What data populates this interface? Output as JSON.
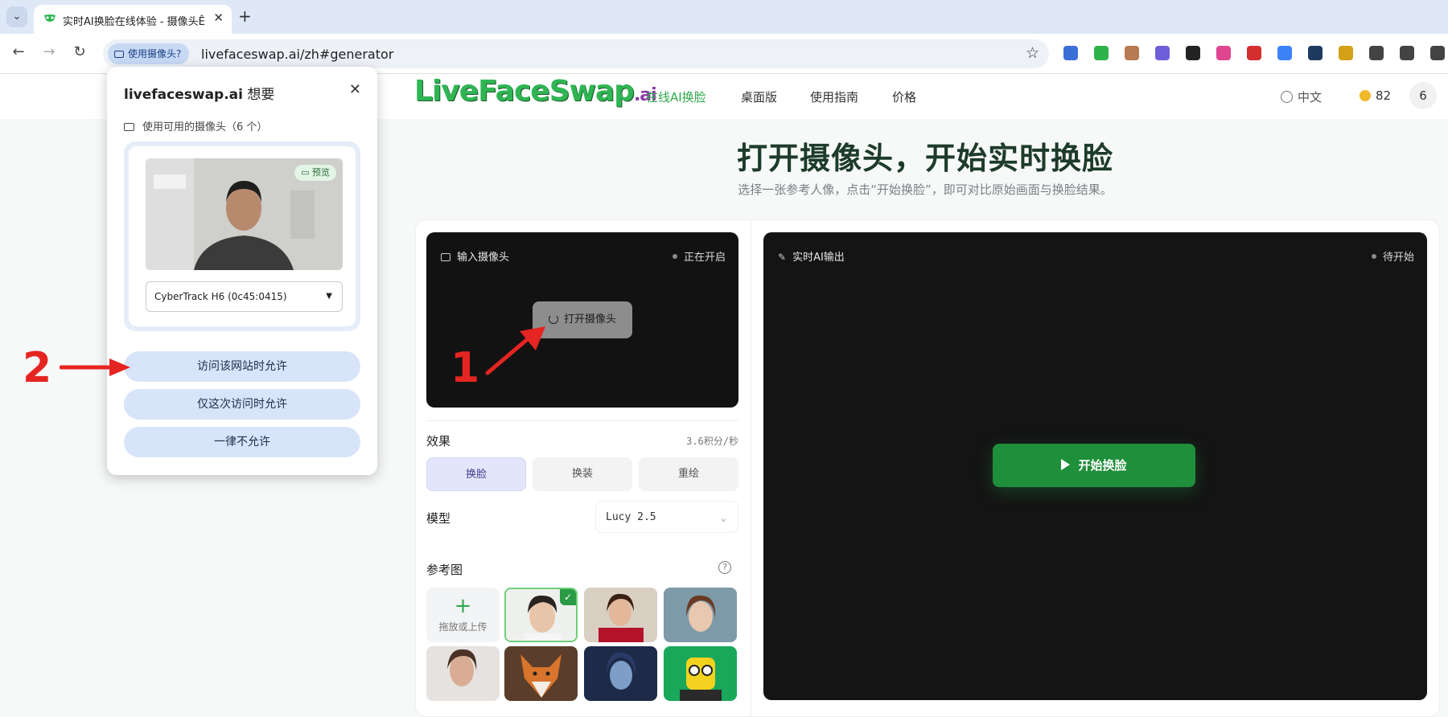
{
  "browser": {
    "tab_title": "实时AI换脸在线体验 - 摄像头Ê",
    "tab_close": "✕",
    "new_tab": "+",
    "camera_chip": "使用摄像头?",
    "url": "livefaceswap.ai/zh#generator",
    "bookmark_icon": "star-icon",
    "extensions": [
      "#3b6fd8",
      "#2eb24a",
      "#b77a52",
      "#6f5ed9",
      "#222222",
      "#e0458f",
      "#d32f2f",
      "#3b82f6",
      "#1e3a5f",
      "#d4a017",
      "#444444",
      "#444444",
      "#444444"
    ]
  },
  "permission_popup": {
    "site": "livefaceswap.ai",
    "wants": "想要",
    "camera_line": "使用可用的摄像头（6 个）",
    "preview_badge": "预览",
    "device": "CyberTrack H6 (0c45:0415)",
    "allow_site": "访问该网站时允许",
    "allow_once": "仅这次访问时允许",
    "never_allow": "一律不允许"
  },
  "site_header": {
    "logo_main": "LiveFaceSwap",
    "logo_suffix": ".ai",
    "nav": [
      "在线AI换脸",
      "桌面版",
      "使用指南",
      "价格"
    ],
    "active_nav": 0,
    "language": "中文",
    "credits": "82",
    "user_initial": "6"
  },
  "hero": {
    "title": "打开摄像头，开始实时换脸",
    "subtitle": "选择一张参考人像，点击“开始换脸”，即可对比原始画面与换脸结果。"
  },
  "input_panel": {
    "label": "输入摄像头",
    "status": "正在开启",
    "open_button": "打开摄像头"
  },
  "output_panel": {
    "label": "实时AI输出",
    "status": "待开始",
    "start_button": "开始换脸"
  },
  "controls": {
    "effect_label": "效果",
    "rate": "3.6积分/秒",
    "effects": [
      "换脸",
      "换装",
      "重绘"
    ],
    "selected_effect": 0,
    "model_label": "模型",
    "model_value": "Lucy 2.5",
    "reference_label": "参考图",
    "upload_label": "拖放或上传",
    "check_mark": "✓"
  },
  "annotations": {
    "step1": "1",
    "step2": "2"
  },
  "colors": {
    "brand_green": "#1f8f3b",
    "accent_nav": "#2fa84a",
    "annotation_red": "#e52521"
  }
}
